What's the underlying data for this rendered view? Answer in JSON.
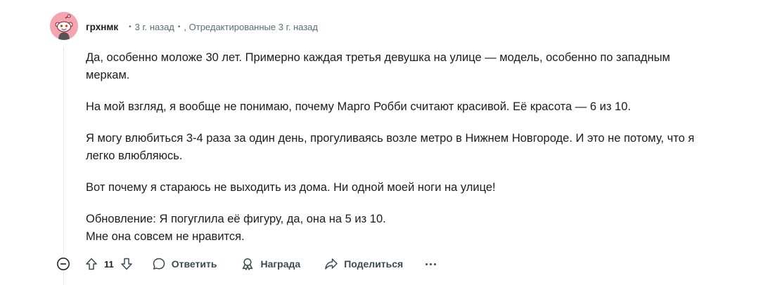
{
  "comment": {
    "author": "грхнмк",
    "time": "3 г. назад",
    "edited": ", Отредактированные 3 г. назад",
    "paragraphs": [
      "Да, особенно моложе 30 лет. Примерно каждая третья девушка на улице — модель, особенно по западным меркам.",
      "На мой взгляд, я вообще не понимаю, почему Марго Робби считают красивой. Её красота — 6 из 10.",
      "Я могу влюбиться 3-4 раза за один день, прогуливаясь возле метро в Нижнем Новгороде. И это не потому, что я легко влюбляюсь.",
      "Вот почему я стараюсь не выходить из дома. Ни одной моей ноги на улице!"
    ],
    "update_line1": "Обновление: Я погуглила её фигуру, да, она на 5 из 10.",
    "update_line2": "Мне она совсем не нравится.",
    "score": "11"
  },
  "actions": {
    "reply": "Ответить",
    "award": "Награда",
    "share": "Поделиться"
  },
  "icons": {
    "avatar": "reddit-snoo-avatar",
    "collapse": "minus-circle-icon",
    "upvote": "arrow-up-icon",
    "downvote": "arrow-down-icon",
    "reply": "speech-bubble-icon",
    "award": "award-icon",
    "share": "share-arrow-icon",
    "more": "more-dots-icon"
  },
  "colors": {
    "avatar_bg": "#f7a4b1",
    "text": "#1c1c1c",
    "meta": "#576f76"
  }
}
